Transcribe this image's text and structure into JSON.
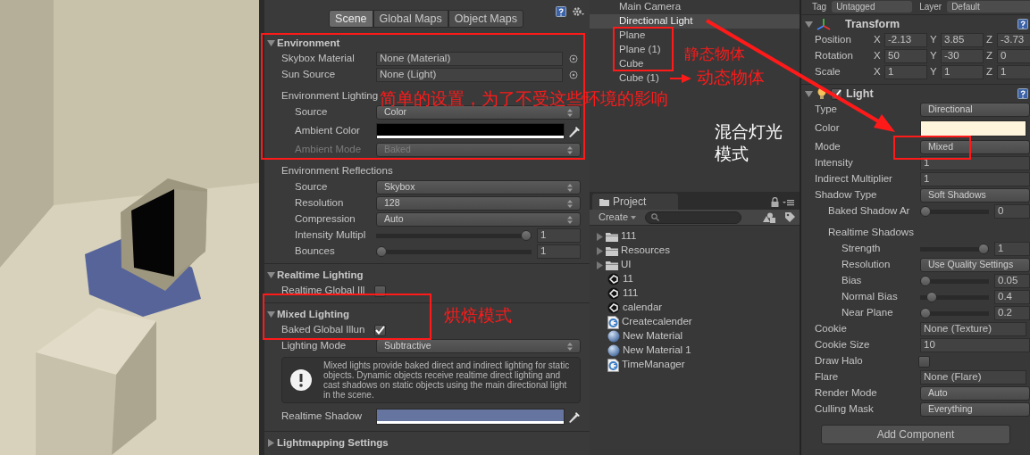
{
  "lighting": {
    "tabs": [
      {
        "label": "Scene",
        "selected": true
      },
      {
        "label": "Global Maps",
        "selected": false
      },
      {
        "label": "Object Maps",
        "selected": false
      }
    ],
    "sections": [
      {
        "title": "Environment",
        "expanded": true,
        "rows": [
          {
            "kind": "object",
            "label": "Skybox Material",
            "value": "None (Material)"
          },
          {
            "kind": "object",
            "label": "Sun Source",
            "value": "None (Light)"
          },
          {
            "kind": "group",
            "label": "Environment Lighting",
            "children": [
              {
                "kind": "dropdown",
                "label": "Source",
                "value": "Color",
                "disabled": false
              },
              {
                "kind": "color",
                "label": "Ambient Color",
                "color": "#000000",
                "disabled": false
              },
              {
                "kind": "dropdown",
                "label": "Ambient Mode",
                "value": "Baked",
                "disabled": true
              }
            ]
          },
          {
            "kind": "group",
            "label": "Environment Reflections",
            "children": [
              {
                "kind": "dropdown",
                "label": "Source",
                "value": "Skybox"
              },
              {
                "kind": "dropdown",
                "label": "Resolution",
                "value": "128"
              },
              {
                "kind": "dropdown",
                "label": "Compression",
                "value": "Auto"
              },
              {
                "kind": "slider",
                "label": "Intensity Multipl",
                "level": 1,
                "value": "1"
              },
              {
                "kind": "slider",
                "label": "Bounces",
                "level": 0,
                "value": "1"
              }
            ]
          }
        ]
      },
      {
        "title": "Realtime Lighting",
        "expanded": true,
        "rows": [
          {
            "kind": "checkbox",
            "label": "Realtime Global Ill",
            "checked": false
          }
        ]
      },
      {
        "title": "Mixed Lighting",
        "expanded": true,
        "rows": [
          {
            "kind": "checkbox",
            "label": "Baked Global Illun",
            "checked": true
          },
          {
            "kind": "dropdown",
            "label": "Lighting Mode",
            "value": "Subtractive"
          },
          {
            "kind": "info",
            "text": "Mixed lights provide baked direct and indirect lighting for static objects. Dynamic objects receive realtime direct lighting and cast shadows on static objects using the main directional light in the scene."
          },
          {
            "kind": "color",
            "label": "Realtime Shadow",
            "color": "#6674a0"
          }
        ]
      },
      {
        "title": "Lightmapping Settings",
        "expanded": false
      }
    ]
  },
  "hierarchy": {
    "items": [
      {
        "label": "Main Camera",
        "selected": false
      },
      {
        "label": "Directional Light",
        "selected": true
      },
      {
        "label": "Plane",
        "selected": false
      },
      {
        "label": "Plane (1)",
        "selected": false
      },
      {
        "label": "Cube",
        "selected": false
      },
      {
        "label": "Cube (1)",
        "selected": false
      }
    ]
  },
  "project": {
    "tab": "Project",
    "create": "Create",
    "items": [
      {
        "kind": "folder",
        "label": "111",
        "expanded": false
      },
      {
        "kind": "folder",
        "label": "Resources",
        "expanded": false
      },
      {
        "kind": "folder",
        "label": "UI",
        "expanded": false
      },
      {
        "kind": "scene",
        "label": "11"
      },
      {
        "kind": "scene",
        "label": "111"
      },
      {
        "kind": "scene",
        "label": "calendar"
      },
      {
        "kind": "script",
        "label": "Createcalender"
      },
      {
        "kind": "material",
        "label": "New Material"
      },
      {
        "kind": "material",
        "label": "New Material 1"
      },
      {
        "kind": "script",
        "label": "TimeManager"
      }
    ]
  },
  "inspector": {
    "tag_label": "Tag",
    "tag": "Untagged",
    "layer_label": "Layer",
    "layer": "Default",
    "components": [
      {
        "title": "Transform",
        "kind": "transform",
        "expanded": true,
        "rows": [
          {
            "kind": "vector",
            "label": "Position",
            "values": [
              {
                "axis": "X",
                "value": "-2.13"
              },
              {
                "axis": "Y",
                "value": "3.85"
              },
              {
                "axis": "Z",
                "value": "-3.73"
              }
            ]
          },
          {
            "kind": "vector",
            "label": "Rotation",
            "values": [
              {
                "axis": "X",
                "value": "50"
              },
              {
                "axis": "Y",
                "value": "-30"
              },
              {
                "axis": "Z",
                "value": "0"
              }
            ]
          },
          {
            "kind": "vector",
            "label": "Scale",
            "values": [
              {
                "axis": "X",
                "value": "1"
              },
              {
                "axis": "Y",
                "value": "1"
              },
              {
                "axis": "Z",
                "value": "1"
              }
            ]
          }
        ]
      },
      {
        "title": "Light",
        "kind": "light",
        "expanded": true,
        "enabled": true,
        "rows": [
          {
            "kind": "dropdown",
            "label": "Type",
            "value": "Directional"
          },
          {
            "kind": "color",
            "label": "Color",
            "color": "#fff4dc"
          },
          {
            "kind": "dropdown",
            "label": "Mode",
            "value": "Mixed"
          },
          {
            "kind": "text",
            "label": "Intensity",
            "value": "1"
          },
          {
            "kind": "text",
            "label": "Indirect Multiplier",
            "value": "1"
          },
          {
            "kind": "dropdown",
            "label": "Shadow Type",
            "value": "Soft Shadows",
            "children": [
              {
                "kind": "slider",
                "label": "Baked Shadow Ar",
                "level": 0,
                "value": "0"
              },
              {
                "kind": "group",
                "label": "Realtime Shadows",
                "children": [
                  {
                    "kind": "slider",
                    "label": "Strength",
                    "level": 1,
                    "value": "1"
                  },
                  {
                    "kind": "dropdown",
                    "label": "Resolution",
                    "value": "Use Quality Settings"
                  },
                  {
                    "kind": "slider",
                    "label": "Bias",
                    "level": 0,
                    "value": "0.05"
                  },
                  {
                    "kind": "slider",
                    "label": "Normal Bias",
                    "level": 0.1,
                    "value": "0.4"
                  },
                  {
                    "kind": "slider",
                    "label": "Near Plane",
                    "level": 0,
                    "value": "0.2"
                  }
                ]
              }
            ]
          },
          {
            "kind": "object",
            "label": "Cookie",
            "value": "None (Texture)"
          },
          {
            "kind": "text",
            "label": "Cookie Size",
            "value": "10"
          },
          {
            "kind": "checkbox",
            "label": "Draw Halo",
            "checked": false
          },
          {
            "kind": "object",
            "label": "Flare",
            "value": "None (Flare)"
          },
          {
            "kind": "dropdown",
            "label": "Render Mode",
            "value": "Auto"
          },
          {
            "kind": "dropdown",
            "label": "Culling Mask",
            "value": "Everything"
          }
        ]
      }
    ],
    "add_button": "Add Component"
  },
  "annotations": [
    {
      "text": "简单的设置，为了不受这些环境的影响",
      "color": "#ff1a1a"
    },
    {
      "text": "静态物体",
      "color": "#ff1a1a"
    },
    {
      "text": "动态物体",
      "color": "#ff1a1a"
    },
    {
      "text": "烘焙模式",
      "color": "#ff1a1a"
    },
    {
      "text": "混合灯光",
      "color": "#ffffff"
    },
    {
      "text": "模式",
      "color": "#ffffff"
    }
  ]
}
